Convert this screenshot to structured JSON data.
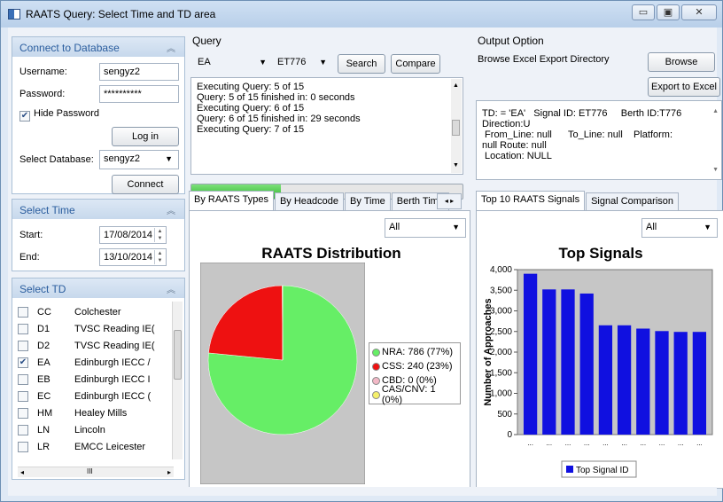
{
  "window": {
    "title": "RAATS Query: Select Time and TD area",
    "controls": [
      "▭",
      "▣",
      "✕"
    ]
  },
  "connect": {
    "title": "Connect to Database",
    "username_label": "Username:",
    "username_value": "sengyz2",
    "password_label": "Password:",
    "password_value": "**********",
    "hide_password_label": "Hide Password",
    "hide_password_checked": true,
    "login_label": "Log in",
    "select_db_label": "Select Database:",
    "select_db_value": "sengyz2",
    "connect_label": "Connect"
  },
  "select_time": {
    "title": "Select Time",
    "start_label": "Start:",
    "start_value": "17/08/2014",
    "end_label": "End:",
    "end_value": "13/10/2014"
  },
  "select_td": {
    "title": "Select TD",
    "items": [
      {
        "code": "CC",
        "name": "Colchester",
        "checked": false
      },
      {
        "code": "D1",
        "name": "TVSC Reading IE(",
        "checked": false
      },
      {
        "code": "D2",
        "name": "TVSC Reading IE(",
        "checked": false
      },
      {
        "code": "EA",
        "name": "Edinburgh IECC /",
        "checked": true
      },
      {
        "code": "EB",
        "name": "Edinburgh IECC I",
        "checked": false
      },
      {
        "code": "EC",
        "name": "Edinburgh IECC (",
        "checked": false
      },
      {
        "code": "HM",
        "name": "Healey Mills",
        "checked": false
      },
      {
        "code": "LN",
        "name": "Lincoln",
        "checked": false
      },
      {
        "code": "LR",
        "name": "EMCC Leicester",
        "checked": false
      }
    ],
    "hscroll_glyph": "III"
  },
  "query": {
    "label": "Query",
    "td_value": "EA",
    "signal_value": "ET776",
    "search_label": "Search",
    "compare_label": "Compare",
    "log_lines": [
      "Executing Query: 5 of 15",
      "Query: 5 of 15 finished in: 0 seconds",
      "Executing Query: 6 of 15",
      "Query: 6 of 15 finished in: 29 seconds",
      "Executing Query: 7 of 15"
    ],
    "progress_fraction": 0.33
  },
  "output": {
    "label": "Output Option",
    "browse_dir_label": "Browse Excel Export Directory",
    "browse_label": "Browse",
    "export_label": "Export to Excel",
    "info_lines": [
      "TD: = 'EA'   Signal ID: ET776     Berth ID:T776",
      "Direction:U",
      " From_Line: null      To_Line: null    Platform:",
      "null Route: null",
      " Location: NULL"
    ]
  },
  "left_tabs": {
    "tabs": [
      "By RAATS Types",
      "By Headcode",
      "By Time",
      "Berth Time"
    ],
    "filter_value": "All",
    "chart_title": "RAATS Distribution",
    "legend": [
      {
        "label": "NRA: 786 (77%)",
        "color": "#66ee66"
      },
      {
        "label": "CSS: 240 (23%)",
        "color": "#ee1111"
      },
      {
        "label": "CBD: 0 (0%)",
        "color": "#f2b8c6"
      },
      {
        "label": "CAS/CNV: 1 (0%)",
        "color": "#f5f06a"
      }
    ]
  },
  "right_tabs": {
    "tabs": [
      "Top 10 RAATS Signals",
      "Signal Comparison"
    ],
    "filter_value": "All",
    "chart_title": "Top Signals",
    "legend_label": "Top Signal ID",
    "xtick_label": "..."
  },
  "chart_data": [
    {
      "type": "pie",
      "title": "RAATS Distribution",
      "categories": [
        "NRA",
        "CSS",
        "CBD",
        "CAS/CNV"
      ],
      "values": [
        786,
        240,
        0,
        1
      ],
      "colors": [
        "#66ee66",
        "#ee1111",
        "#f2b8c6",
        "#f5f06a"
      ]
    },
    {
      "type": "bar",
      "title": "Top Signals",
      "ylabel": "Number of Approaches",
      "xlabel": "",
      "ylim": [
        0,
        4000
      ],
      "yticks": [
        0,
        500,
        1000,
        1500,
        2000,
        2500,
        3000,
        3500,
        4000
      ],
      "ytick_labels": [
        "0",
        "500",
        "1,000",
        "1,500",
        "2,000",
        "2,500",
        "3,000",
        "3,500",
        "4,000"
      ],
      "series": [
        {
          "name": "Top Signal ID",
          "values": [
            3900,
            3520,
            3520,
            3420,
            2650,
            2650,
            2570,
            2510,
            2490,
            2490
          ]
        }
      ],
      "colors": {
        "bar": "#1010e0",
        "plot_bg": "#c6c6c6"
      }
    }
  ]
}
